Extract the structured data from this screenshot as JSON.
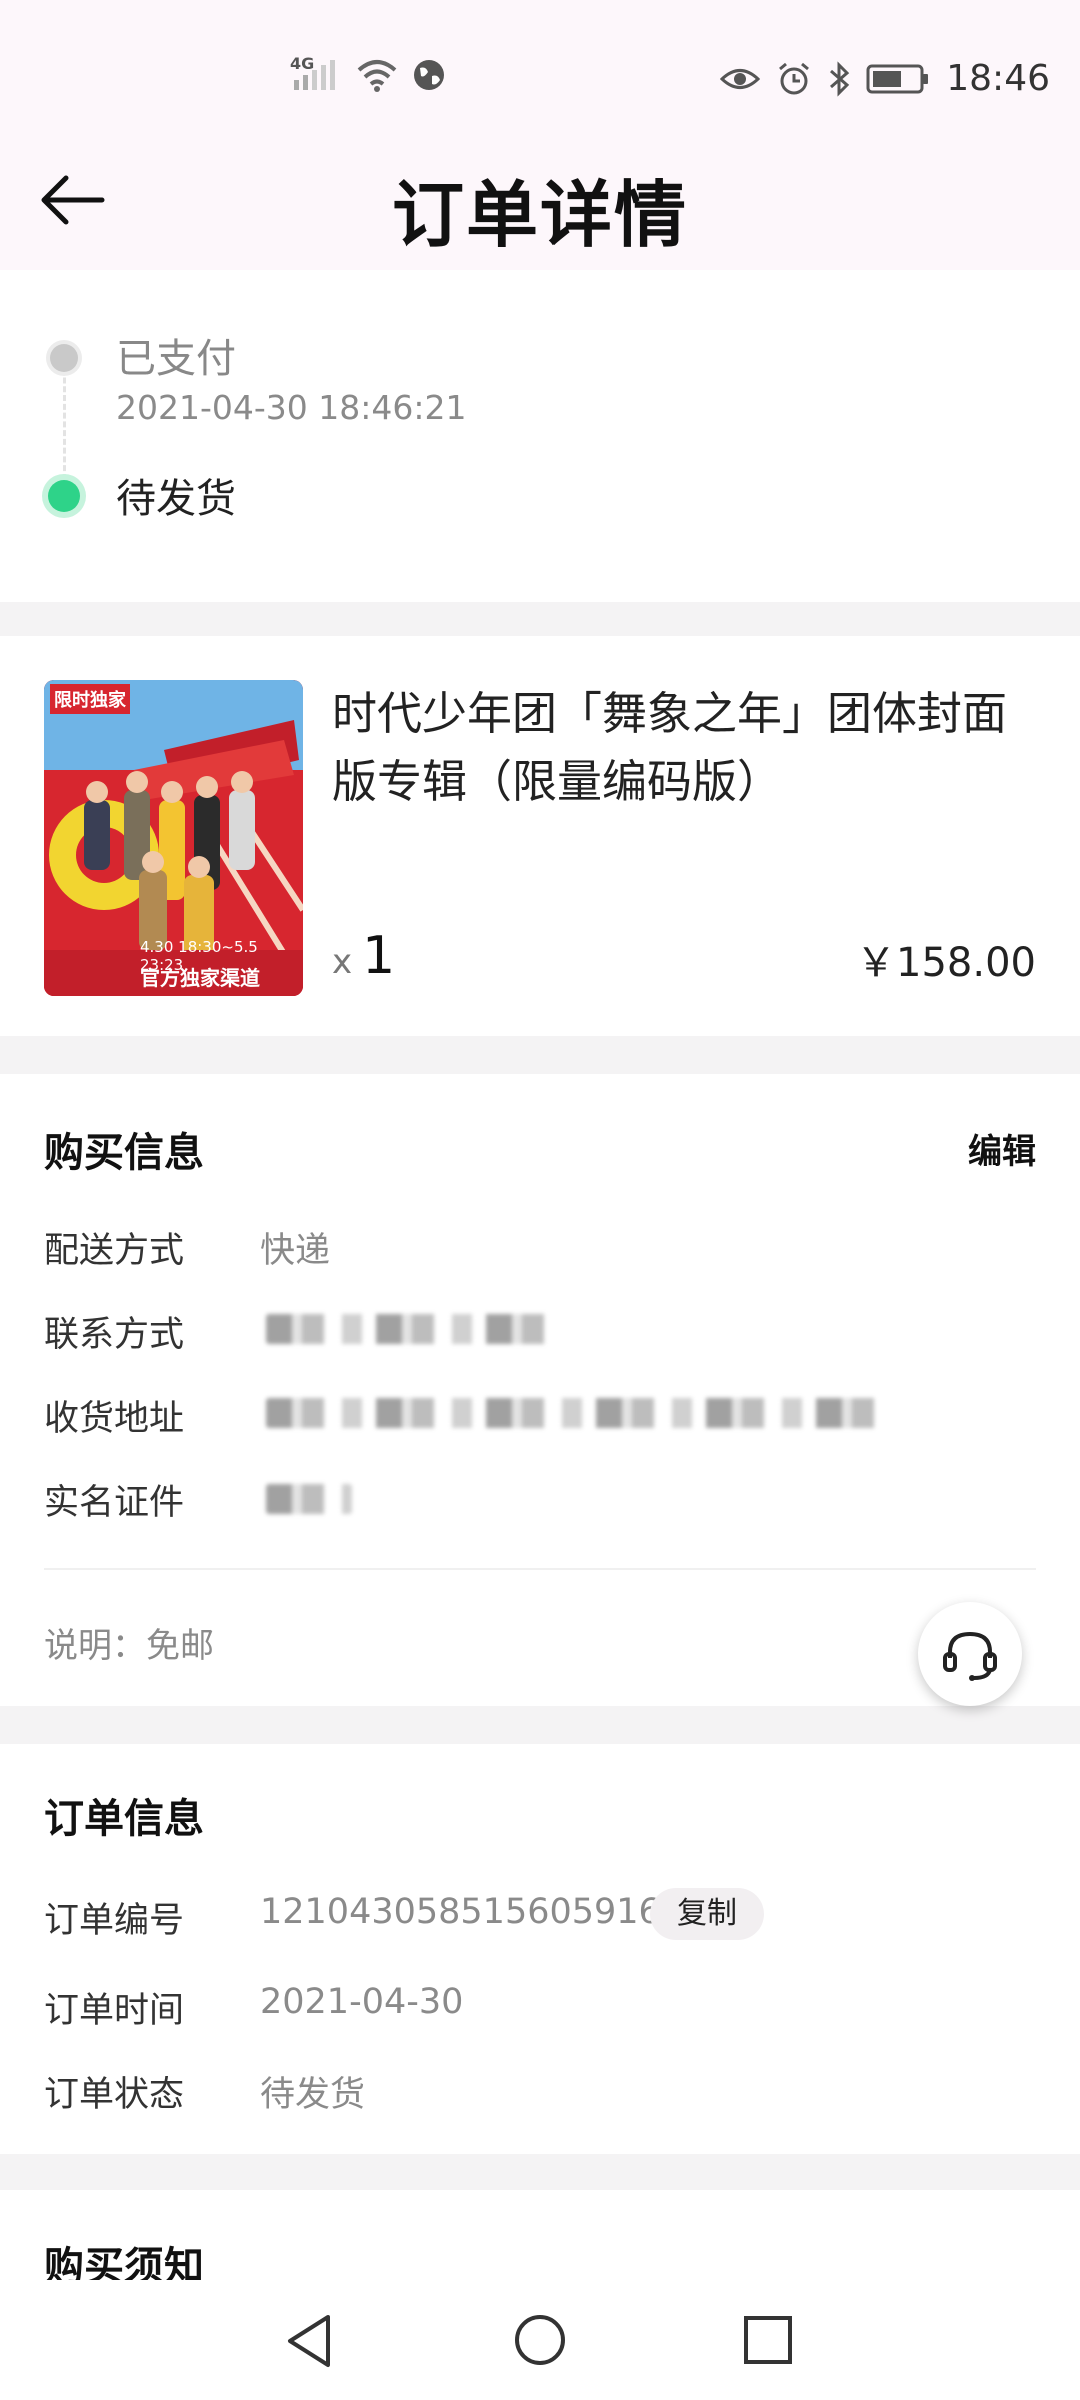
{
  "status_bar": {
    "network_label": "4G",
    "time": "18:46"
  },
  "header": {
    "title": "订单详情"
  },
  "timeline": {
    "steps": [
      {
        "status": "已支付",
        "time": "2021-04-30 18:46:21"
      },
      {
        "status": "待发货"
      }
    ]
  },
  "product": {
    "name": "时代少年团「舞象之年」团体封面版专辑（限量编码版）",
    "qty_prefix": "x",
    "qty": "1",
    "price": "￥158.00",
    "cover": {
      "tag": "限时独家",
      "channel": "官方独家渠道",
      "date_range": "4.30 18:30~5.5 23:23"
    }
  },
  "purchase_info": {
    "title": "购买信息",
    "edit_label": "编辑",
    "rows": [
      {
        "label": "配送方式",
        "value": "快递"
      },
      {
        "label": "联系方式",
        "value": ""
      },
      {
        "label": "收货地址",
        "value": ""
      },
      {
        "label": "实名证件",
        "value": ""
      }
    ],
    "note": "说明：免邮"
  },
  "order_info": {
    "title": "订单信息",
    "copy_label": "复制",
    "rows": [
      {
        "label": "订单编号",
        "value": "1210430585156059166"
      },
      {
        "label": "订单时间",
        "value": "2021-04-30"
      },
      {
        "label": "订单状态",
        "value": "待发货"
      }
    ]
  },
  "notice": {
    "title": "购买须知"
  },
  "colors": {
    "accent_green": "#2ed389",
    "header_bg": "#fdf7fb",
    "cover_red": "#c21f2a"
  }
}
